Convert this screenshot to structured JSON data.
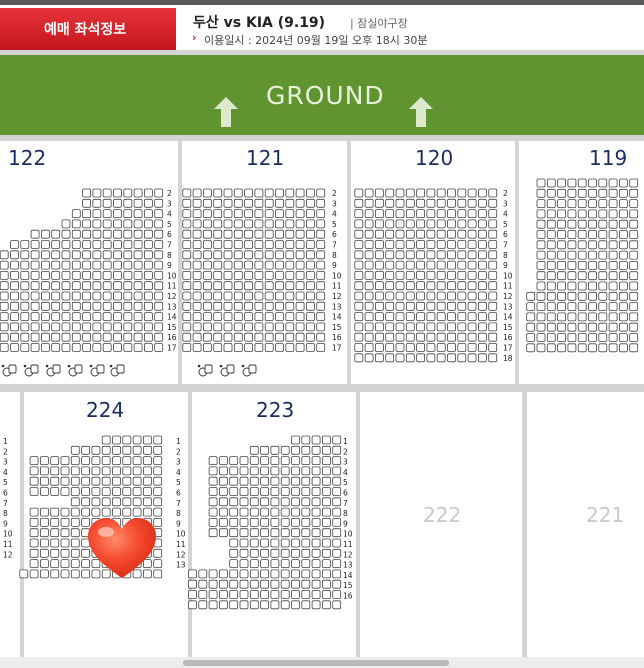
{
  "header": {
    "tab_label": "예매 좌석정보",
    "game_title": "두산 vs KIA (9.19)",
    "venue": "| 잠실야구장",
    "date_chevron": "›",
    "usage_date": "이용일시 : 2024년 09월 19일 오후 18시 30분"
  },
  "field": {
    "label": "GROUND"
  },
  "sections": [
    {
      "name": "122",
      "status": "available"
    },
    {
      "name": "121",
      "status": "available"
    },
    {
      "name": "120",
      "status": "available"
    },
    {
      "name": "119",
      "status": "available"
    },
    {
      "name": "224",
      "status": "available"
    },
    {
      "name": "223",
      "status": "available"
    },
    {
      "name": "222",
      "status": "unavailable"
    },
    {
      "name": "221",
      "status": "unavailable"
    }
  ],
  "colors": {
    "brand_red": "#d0171e",
    "ground_green": "#5f9431",
    "section_number": "#1c2b5e",
    "heart": "#f44a2e"
  },
  "icons": [
    "up-arrow-icon",
    "wheelchair-icon",
    "heart-icon"
  ]
}
